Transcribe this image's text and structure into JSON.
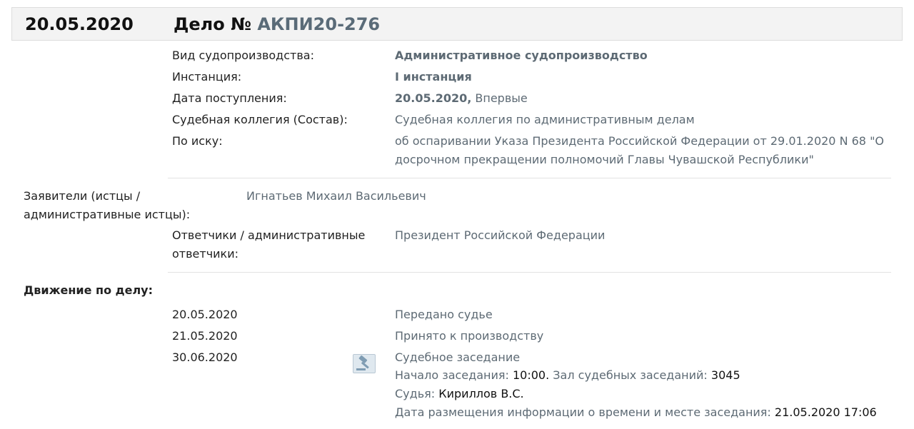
{
  "header": {
    "date": "20.05.2020",
    "case_label": "Дело №",
    "case_number": "АКПИ20-276"
  },
  "info": {
    "proceeding_label": "Вид судопроизводства:",
    "proceeding_value": "Административное судопроизводство",
    "instance_label": "Инстанция:",
    "instance_value": "I инстанция",
    "received_label": "Дата поступления:",
    "received_date": "20.05.2020,",
    "received_note": "Впервые",
    "board_label": "Судебная коллегия (Состав):",
    "board_value": "Судебная коллегия по административным делам",
    "claim_label": "По иску:",
    "claim_line1": "об оспаривании Указа Президента Российской Федерации от 29.01.2020 N 68 \"О",
    "claim_line2": "досрочном прекращении полномочий Главы Чувашской Республики\""
  },
  "parties": {
    "applicants_label_line1": "Заявители (истцы /",
    "applicants_label_line2": "административные истцы):",
    "applicants_value": "Игнатьев Михаил Васильевич",
    "respondents_label_line1": "Ответчики / административные",
    "respondents_label_line2": "ответчики:",
    "respondents_value": "Президент Российской Федерации"
  },
  "movement": {
    "title": "Движение по делу:",
    "events": [
      {
        "date": "20.05.2020",
        "text": "Передано судье"
      },
      {
        "date": "21.05.2020",
        "text": "Принято к производству"
      },
      {
        "date": "30.06.2020",
        "text": "Судебное заседание"
      }
    ],
    "session": {
      "start_label": "Начало заседания:",
      "start_value": "10:00.",
      "hall_label": "Зал судебных заседаний:",
      "hall_value": "3045",
      "judge_label": "Судья:",
      "judge_value": "Кириллов В.С.",
      "posted_label": "Дата размещения информации о времени и месте заседания:",
      "posted_value": "21.05.2020 17:06"
    }
  }
}
